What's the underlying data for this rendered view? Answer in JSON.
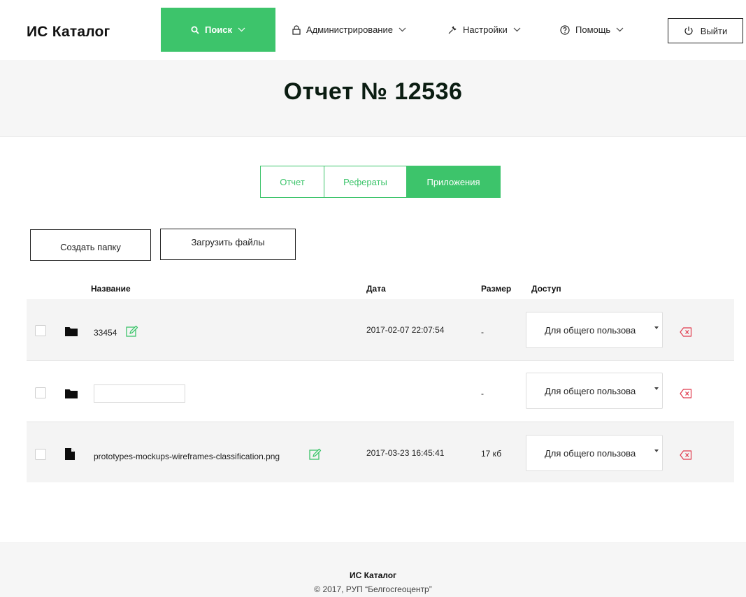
{
  "header": {
    "brand": "ИС Каталог",
    "nav": {
      "search": "Поиск",
      "admin": "Администрирование",
      "settings": "Настройки",
      "help": "Помощь"
    },
    "logout": "Выйти",
    "accent_color": "#3dc46b"
  },
  "page": {
    "title": "Отчет № 12536"
  },
  "tabs": [
    {
      "label": "Отчет",
      "active": false
    },
    {
      "label": "Рефераты",
      "active": false
    },
    {
      "label": "Приложения",
      "active": true
    }
  ],
  "actions": {
    "create_folder": "Создать папку",
    "upload_files": "Загрузить файлы"
  },
  "table": {
    "columns": {
      "name": "Название",
      "date": "Дата",
      "size": "Размер",
      "access": "Доступ"
    },
    "rows": [
      {
        "type": "folder-icon",
        "name": "33454",
        "date": "2017-02-07 22:07:54",
        "size": "-",
        "access": "Для общего пользова"
      },
      {
        "type": "folder-icon",
        "name": "",
        "date": "",
        "size": "-",
        "access": "Для общего пользова"
      },
      {
        "type": "file-icon",
        "name": "prototypes-mockups-wireframes-classification.png",
        "date": "2017-03-23 16:45:41",
        "size": "17 кб",
        "access": "Для общего пользова"
      }
    ]
  },
  "footer": {
    "brand": "ИС Каталог",
    "copyright": "© 2017, РУП “Белгосгеоцентр”"
  }
}
